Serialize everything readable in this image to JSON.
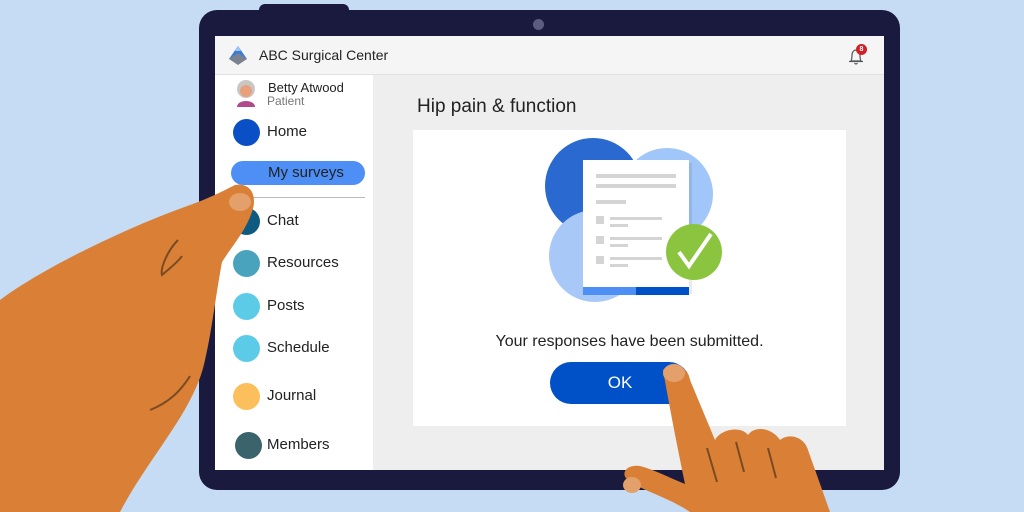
{
  "app": {
    "title": "ABC Surgical Center",
    "logo_icon": "triangle-logo-icon",
    "notifications": {
      "icon": "bell-icon",
      "count": "8",
      "badge_color": "#d0202a"
    }
  },
  "user": {
    "name": "Betty Atwood",
    "role": "Patient",
    "avatar": "elderly-woman-avatar"
  },
  "sidebar": {
    "items": [
      {
        "label": "Home",
        "color": "#0a4fc5",
        "active": false
      },
      {
        "label": "My surveys",
        "color": "#4e8ff5",
        "active": true
      },
      {
        "label": "Chat",
        "color": "#0e5a80",
        "active": false
      },
      {
        "label": "Resources",
        "color": "#4aa3bc",
        "active": false
      },
      {
        "label": "Posts",
        "color": "#5ccbe8",
        "active": false
      },
      {
        "label": "Schedule",
        "color": "#5ccbe8",
        "active": false
      },
      {
        "label": "Journal",
        "color": "#fbbf5c",
        "active": false
      },
      {
        "label": "Members",
        "color": "#3a636c",
        "active": false
      }
    ]
  },
  "main": {
    "title": "Hip pain & function",
    "illustration": "survey-submitted-checkmark-icon",
    "message": "Your responses have been submitted.",
    "ok_label": "OK",
    "accent": "#0050c8",
    "success_color": "#8bc53f"
  }
}
